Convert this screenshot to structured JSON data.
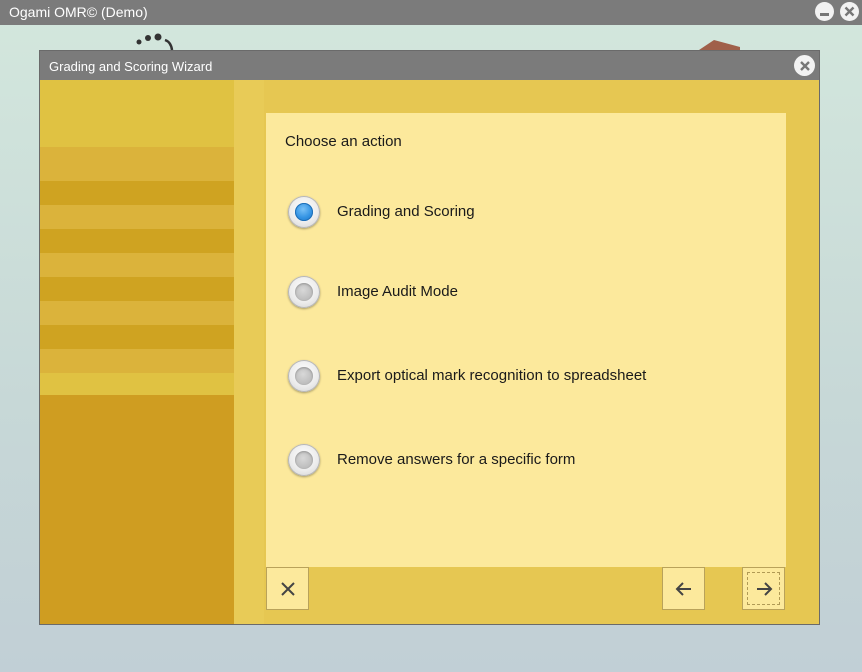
{
  "app": {
    "title": "Ogami OMR© (Demo)"
  },
  "wizard": {
    "title": "Grading and Scoring Wizard",
    "prompt": "Choose an action",
    "options": [
      {
        "label": "Grading and Scoring",
        "selected": true
      },
      {
        "label": "Image Audit Mode",
        "selected": false
      },
      {
        "label": "Export optical mark recognition to spreadsheet",
        "selected": false
      },
      {
        "label": "Remove answers for a specific form",
        "selected": false
      }
    ],
    "icons": {
      "cancel": "close-x-icon",
      "back": "arrow-left-icon",
      "next": "arrow-right-icon"
    }
  },
  "colors": {
    "titlebar": "#7b7b7b",
    "sidebar": "#cf9d21",
    "panel": "#fce99c",
    "radio_selected": "#3393e3"
  }
}
